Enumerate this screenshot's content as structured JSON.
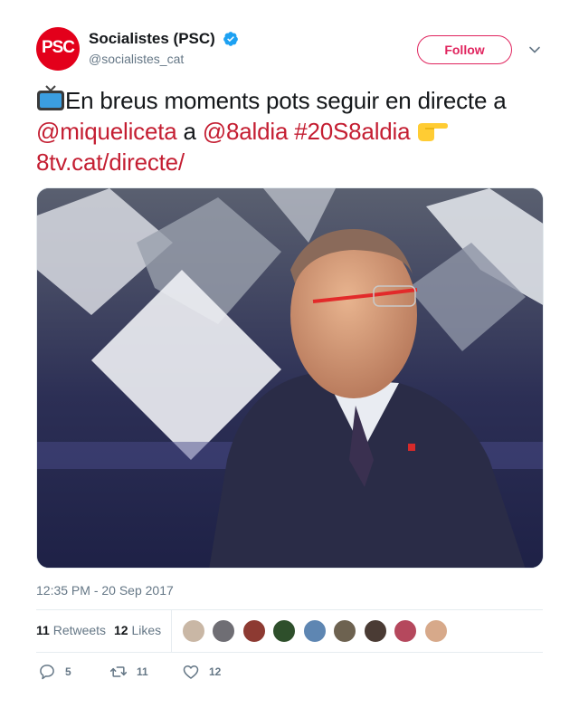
{
  "account": {
    "display_name": "Socialistes (PSC)",
    "handle": "@socialistes_cat",
    "avatar_text": "PSC",
    "verified_icon": "verified-badge-icon",
    "follow_label": "Follow",
    "menu_icon": "chevron-down-icon"
  },
  "tweet": {
    "text_main": "En breus moments pots seguir en directe a ",
    "mention_1": "@miqueliceta",
    "connector": " a ",
    "mention_2": "@8aldia",
    "hashtag": "#20S8aldia",
    "url": "8tv.cat/directe/",
    "emoji_start": "tv-emoji",
    "emoji_end": "pointing-right-emoji",
    "media_alt": "man-in-tv-studio-photo"
  },
  "meta": {
    "timestamp": "12:35 PM - 20 Sep 2017"
  },
  "stats": {
    "retweets_count": "11",
    "retweets_label": "Retweets",
    "likes_count": "12",
    "likes_label": "Likes"
  },
  "actions": {
    "reply_count": "5",
    "retweet_count": "11",
    "like_count": "12"
  },
  "colors": {
    "brand_red": "#e3001b",
    "link_red": "#c41e32",
    "follow_pink": "#e0245e",
    "verified_blue": "#1da1f2",
    "secondary_text": "#657786"
  }
}
